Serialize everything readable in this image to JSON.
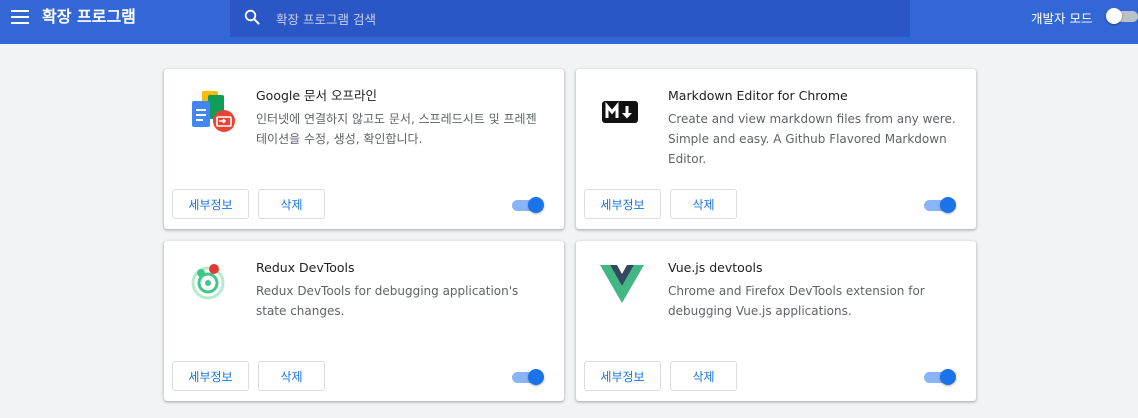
{
  "header": {
    "title": "확장 프로그램",
    "search_placeholder": "확장 프로그램 검색",
    "dev_mode_label": "개발자 모드",
    "dev_mode_on": false
  },
  "colors": {
    "header_bg": "#3367d6",
    "search_bg": "#2a56c6",
    "accent": "#1a73e8",
    "page_bg": "#f1f3f4"
  },
  "extensions": [
    {
      "name": "Google 문서 오프라인",
      "description": "인터넷에 연결하지 않고도 문서, 스프레드시트 및 프레젠테이션을 수정, 생성, 확인합니다.",
      "icon": "google-docs-offline-icon",
      "details_label": "세부정보",
      "remove_label": "삭제",
      "enabled": true
    },
    {
      "name": "Markdown Editor for Chrome",
      "description": "Create and view markdown files from any were. Simple and easy. A Github Flavored Markdown Editor.",
      "icon": "markdown-icon",
      "details_label": "세부정보",
      "remove_label": "삭제",
      "enabled": true
    },
    {
      "name": "Redux DevTools",
      "description": "Redux DevTools for debugging application's state changes.",
      "icon": "redux-devtools-icon",
      "details_label": "세부정보",
      "remove_label": "삭제",
      "enabled": true
    },
    {
      "name": "Vue.js devtools",
      "description": "Chrome and Firefox DevTools extension for debugging Vue.js applications.",
      "icon": "vue-icon",
      "details_label": "세부정보",
      "remove_label": "삭제",
      "enabled": true
    }
  ]
}
